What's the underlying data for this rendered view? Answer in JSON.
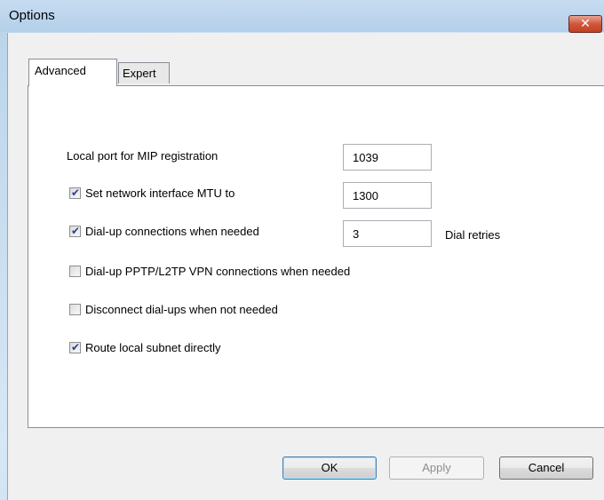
{
  "window": {
    "title": "Options",
    "close_icon": "close-icon"
  },
  "tabs": [
    {
      "label": "Advanced",
      "active": true
    },
    {
      "label": "Expert",
      "active": false
    }
  ],
  "settings": {
    "local_port_label": "Local port for MIP registration",
    "local_port_value": "1039",
    "mtu_label": "Set network interface MTU to",
    "mtu_checked": true,
    "mtu_value": "1300",
    "dialup_label": "Dial-up connections when needed",
    "dialup_checked": true,
    "dialup_retries_value": "3",
    "dial_retries_label": "Dial retries",
    "vpn_label": "Dial-up PPTP/L2TP VPN connections when needed",
    "vpn_checked": false,
    "disconnect_label": "Disconnect dial-ups when not needed",
    "disconnect_checked": false,
    "route_label": "Route local subnet directly",
    "route_checked": true
  },
  "buttons": {
    "ok": "OK",
    "apply": "Apply",
    "cancel": "Cancel"
  },
  "colors": {
    "accent": "#c23f21",
    "checkmark": "#2b3f8e"
  }
}
